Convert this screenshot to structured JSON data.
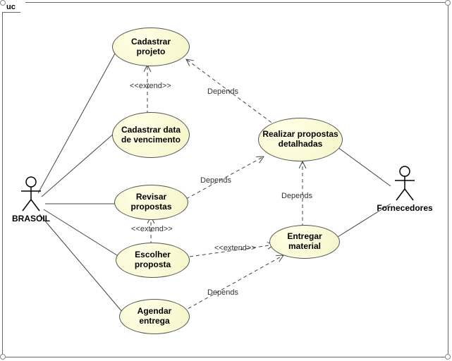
{
  "diagram": {
    "frame_label": "uc",
    "type": "uml-use-case"
  },
  "actors": {
    "brasoil": {
      "name": "BRASOIL"
    },
    "fornecedores": {
      "name": "Fornecedores"
    }
  },
  "usecases": {
    "cadastrar_projeto": "Cadastrar projeto",
    "cadastrar_data_vencimento": "Cadastrar data de vencimento",
    "revisar_propostas": "Revisar propostas",
    "escolher_proposta": "Escolher proposta",
    "agendar_entrega": "Agendar entrega",
    "realizar_propostas_detalhadas": "Realizar propostas detalhadas",
    "entregar_material": "Entregar material"
  },
  "labels": {
    "extend": "<<extend>>",
    "depends": "Depends"
  },
  "chart_data": {
    "type": "uml-use-case-diagram",
    "actors": [
      "BRASOIL",
      "Fornecedores"
    ],
    "use_cases": [
      "Cadastrar projeto",
      "Cadastrar data de vencimento",
      "Revisar propostas",
      "Escolher proposta",
      "Agendar entrega",
      "Realizar propostas detalhadas",
      "Entregar material"
    ],
    "associations": [
      {
        "actor": "BRASOIL",
        "usecase": "Cadastrar projeto"
      },
      {
        "actor": "BRASOIL",
        "usecase": "Cadastrar data de vencimento"
      },
      {
        "actor": "BRASOIL",
        "usecase": "Revisar propostas"
      },
      {
        "actor": "BRASOIL",
        "usecase": "Escolher proposta"
      },
      {
        "actor": "BRASOIL",
        "usecase": "Agendar entrega"
      },
      {
        "actor": "Fornecedores",
        "usecase": "Realizar propostas detalhadas"
      },
      {
        "actor": "Fornecedores",
        "usecase": "Entregar material"
      }
    ],
    "dependencies": [
      {
        "from": "Cadastrar data de vencimento",
        "to": "Cadastrar projeto",
        "stereotype": "extend"
      },
      {
        "from": "Realizar propostas detalhadas",
        "to": "Cadastrar projeto",
        "stereotype": "Depends"
      },
      {
        "from": "Revisar propostas",
        "to": "Realizar propostas detalhadas",
        "stereotype": "Depends"
      },
      {
        "from": "Escolher proposta",
        "to": "Revisar propostas",
        "stereotype": "extend"
      },
      {
        "from": "Entregar material",
        "to": "Realizar propostas detalhadas",
        "stereotype": "Depends"
      },
      {
        "from": "Escolher proposta",
        "to": "Entregar material",
        "stereotype": "extend"
      },
      {
        "from": "Agendar entrega",
        "to": "Entregar material",
        "stereotype": "Depends"
      }
    ]
  }
}
